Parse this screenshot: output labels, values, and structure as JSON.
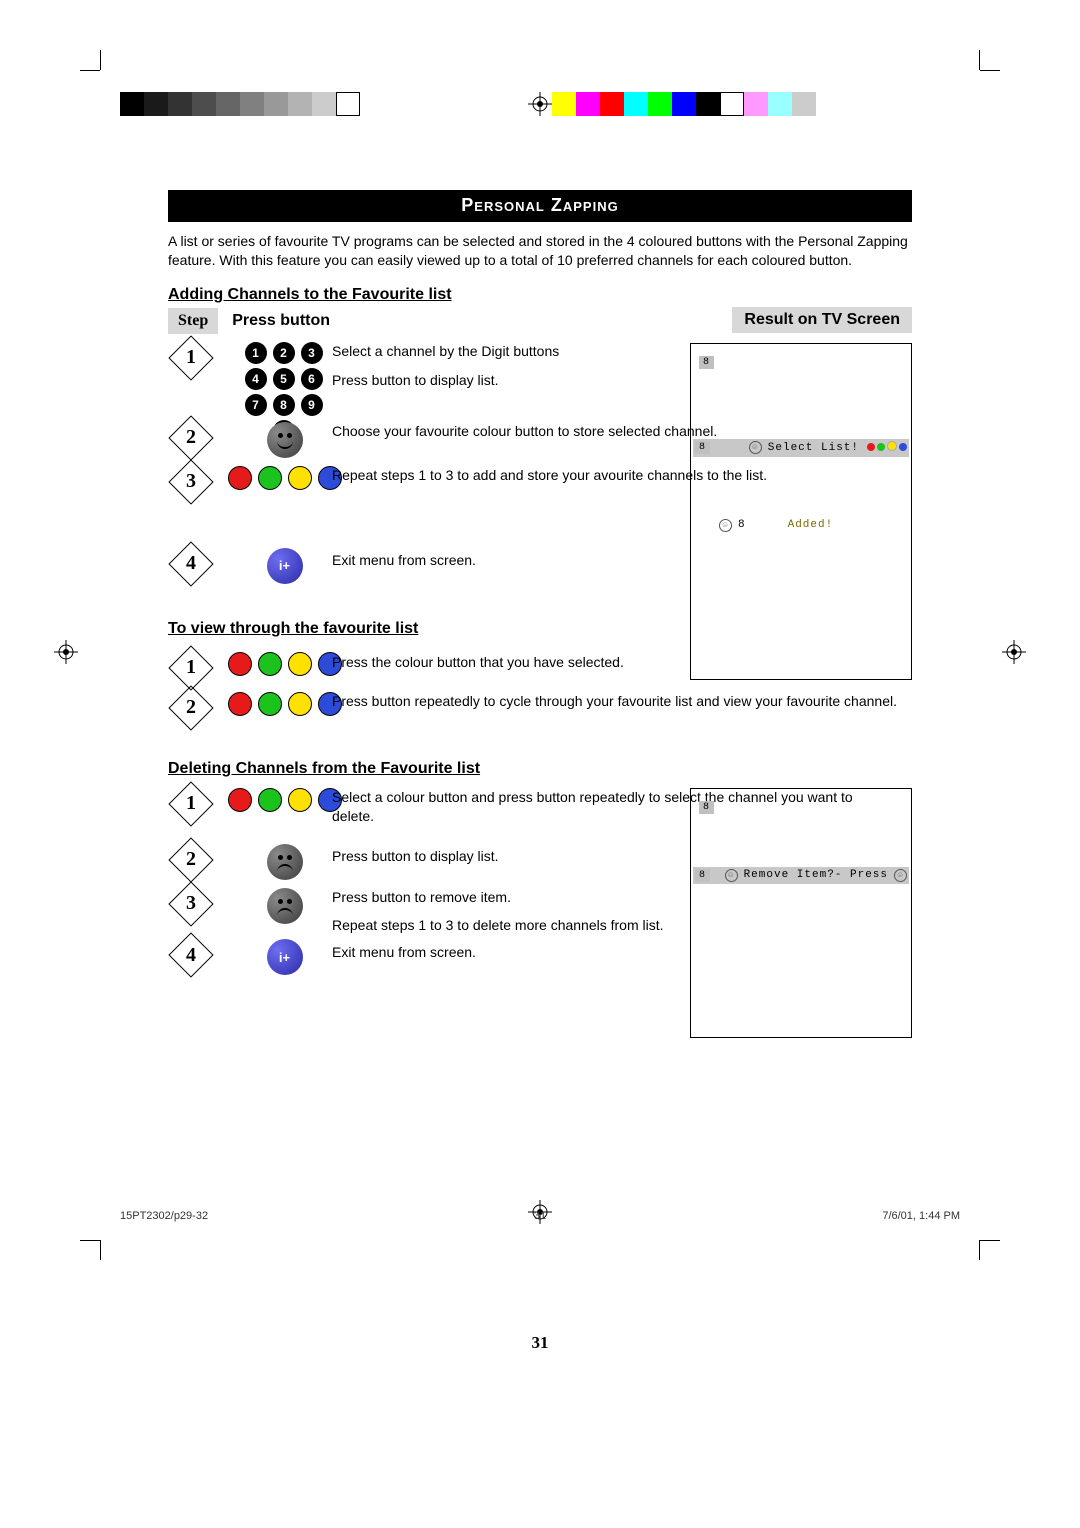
{
  "title": "Personal Zapping",
  "intro": "A list or series of favourite TV programs can be selected and stored in the 4 coloured buttons with the Personal Zapping feature. With this feature you can easily viewed up to a total of 10 preferred channels for each coloured button.",
  "headers": {
    "adding": "Adding Channels to the Favourite list",
    "viewing": "To view through the favourite list",
    "deleting": "Deleting Channels from the Favourite list",
    "step": "Step",
    "press": "Press button",
    "result": "Result on TV Screen"
  },
  "adding": {
    "s1": {
      "p1": "Select a channel by the Digit buttons",
      "p2": "Press button to display list."
    },
    "s2": {
      "p1": "Choose your favourite colour button to store selected channel."
    },
    "s3": {
      "p1": "Repeat steps 1 to 3 to add and store your avourite channels to the list."
    },
    "s4": {
      "p1": "Exit menu from screen."
    }
  },
  "viewing": {
    "s1": "Press the colour button that you have selected.",
    "s2": "Press button repeatedly to cycle through your favourite list and view your favourite channel."
  },
  "deleting": {
    "s1": "Select a colour button and press button repeatedly to select the channel you want to delete.",
    "s2": "Press button to display list.",
    "s3a": "Press button to remove item.",
    "s3b": "Repeat steps 1 to 3 to delete more channels from list.",
    "s4": "Exit menu from screen."
  },
  "tv1": {
    "ch": "8",
    "select": "Select List!",
    "added": "Added!"
  },
  "tv2": {
    "ch": "8",
    "remove": "Remove Item?- Press"
  },
  "exit_glyph": "i+",
  "page_number": "31",
  "footer": {
    "left": "15PT2302/p29-32",
    "mid": "31",
    "right": "7/6/01, 1:44 PM"
  }
}
